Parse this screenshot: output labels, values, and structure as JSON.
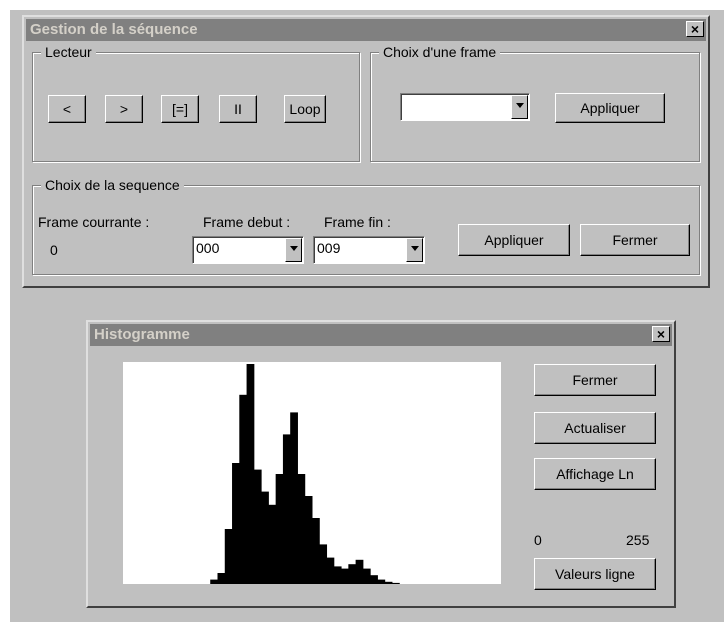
{
  "sequence_window": {
    "title": "Gestion de la séquence",
    "close_glyph": "×",
    "player": {
      "legend": "Lecteur",
      "buttons": [
        "<",
        ">",
        "[=]",
        "II",
        "Loop"
      ]
    },
    "frame_choice": {
      "legend": "Choix d'une frame",
      "selected": "",
      "apply_label": "Appliquer"
    },
    "sequence_choice": {
      "legend": "Choix de la sequence",
      "current_frame_label": "Frame courrante :",
      "current_frame_value": "0",
      "start_label": "Frame debut :",
      "start_value": "000",
      "end_label": "Frame fin :",
      "end_value": "009",
      "apply_label": "Appliquer",
      "close_label": "Fermer"
    }
  },
  "histogram_window": {
    "title": "Histogramme",
    "close_glyph": "×",
    "buttons": {
      "close": "Fermer",
      "refresh": "Actualiser",
      "log_display": "Affichage Ln",
      "line_values": "Valeurs ligne"
    },
    "range_min": "0",
    "range_max": "255"
  },
  "chart_data": {
    "type": "bar",
    "x_domain": [
      0,
      255
    ],
    "grid": false,
    "color": "#000000",
    "x": [
      0,
      5,
      10,
      15,
      20,
      25,
      30,
      35,
      40,
      45,
      50,
      55,
      60,
      65,
      70,
      75,
      80,
      85,
      90,
      95,
      100,
      105,
      110,
      115,
      120,
      125,
      130,
      135,
      140,
      145,
      150,
      155,
      160,
      165,
      170,
      175,
      180,
      185,
      190,
      195,
      200,
      205,
      210,
      215,
      220,
      225,
      230,
      235,
      240,
      245,
      250,
      255
    ],
    "values": [
      0,
      0,
      0,
      0,
      0,
      0,
      0,
      0,
      0,
      0,
      0,
      0,
      0.02,
      0.05,
      0.25,
      0.55,
      0.86,
      1.0,
      0.52,
      0.42,
      0.36,
      0.5,
      0.68,
      0.78,
      0.5,
      0.4,
      0.3,
      0.18,
      0.12,
      0.08,
      0.07,
      0.09,
      0.11,
      0.07,
      0.04,
      0.02,
      0.01,
      0.005,
      0,
      0,
      0,
      0,
      0,
      0,
      0,
      0,
      0,
      0,
      0,
      0,
      0,
      0
    ]
  }
}
